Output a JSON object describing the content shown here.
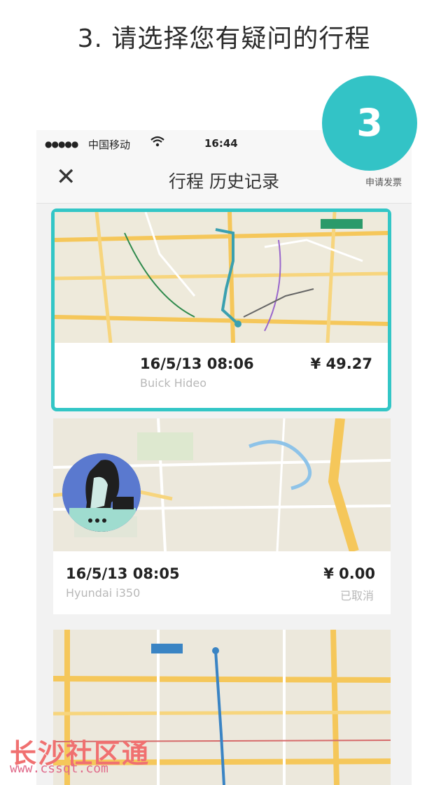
{
  "page_heading": "3. 请选择您有疑问的行程",
  "step_badge": "3",
  "status_bar": {
    "signal": "●●●●●",
    "carrier": "中国移动",
    "time": "16:44"
  },
  "nav": {
    "title": "行程 历史记录",
    "right_action": "申请发票"
  },
  "accent_color": "#33c6c6",
  "trips": [
    {
      "datetime": "16/5/13 08:06",
      "car": "Buick Hideo",
      "price": "¥ 49.27",
      "status": "",
      "selected": true
    },
    {
      "datetime": "16/5/13 08:05",
      "car": "Hyundai i350",
      "price": "¥ 0.00",
      "status": "已取消",
      "selected": false
    }
  ],
  "watermark": {
    "line1": "长沙社区通",
    "line2": "www.cssqt.com"
  }
}
